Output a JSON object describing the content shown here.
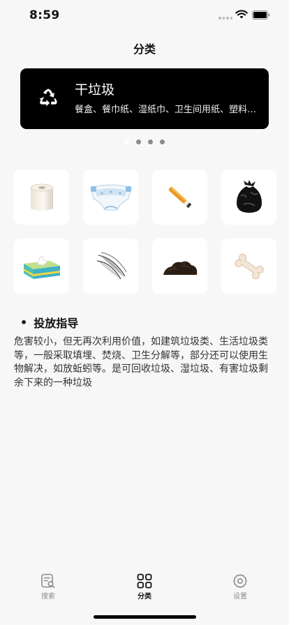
{
  "status": {
    "time": "8:59"
  },
  "nav": {
    "title": "分类"
  },
  "banner": {
    "title": "干垃圾",
    "subtitle": "餐盒、餐巾纸、湿纸巾、卫生间用纸、塑料袋、食品包装袋",
    "icon": "recycle-icon"
  },
  "pager": {
    "count": 4,
    "active_index": 0
  },
  "grid": {
    "items": [
      {
        "icon": "toilet-paper-roll"
      },
      {
        "icon": "diaper"
      },
      {
        "icon": "cigarette-butt"
      },
      {
        "icon": "black-garbage-bag"
      },
      {
        "icon": "tissue-box"
      },
      {
        "icon": "feathers"
      },
      {
        "icon": "dirt-pile"
      },
      {
        "icon": "bone"
      }
    ]
  },
  "guide": {
    "heading": "投放指导",
    "text": "危害较小，但无再次利用价值，如建筑垃圾类、生活垃圾类等，一般采取填埋、焚烧、卫生分解等，部分还可以使用生物解决，如放蚯蚓等。是可回收垃圾、湿垃圾、有害垃圾剩余下来的一种垃圾"
  },
  "tabbar": {
    "items": [
      {
        "label": "搜索",
        "icon": "search-doc-icon",
        "active": false
      },
      {
        "label": "分类",
        "icon": "grid-icon",
        "active": true
      },
      {
        "label": "设置",
        "icon": "gear-icon",
        "active": false
      }
    ]
  },
  "colors": {
    "background": "#f7f7f7",
    "banner": "#000000",
    "tile": "#ffffff",
    "inactive_tab": "#8c8c8c"
  }
}
